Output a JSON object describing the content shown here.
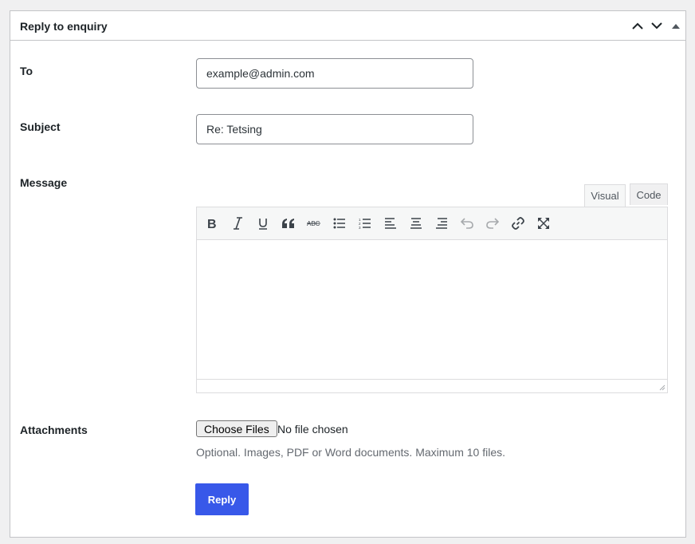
{
  "panel": {
    "title": "Reply to enquiry",
    "controls": {
      "move_up": "chevron-up-icon",
      "move_down": "chevron-down-icon",
      "toggle": "triangle-up-icon"
    }
  },
  "form": {
    "to": {
      "label": "To",
      "value": "example@admin.com"
    },
    "subject": {
      "label": "Subject",
      "value": "Re: Tetsing"
    },
    "message": {
      "label": "Message",
      "tabs": [
        "Visual",
        "Code"
      ],
      "active_tab": "Visual",
      "content": ""
    },
    "attachments": {
      "label": "Attachments",
      "button_label": "Choose Files",
      "status": "No file chosen",
      "help": "Optional. Images, PDF or Word documents. Maximum 10 files."
    },
    "submit_label": "Reply"
  },
  "toolbar_icons": [
    "bold-icon",
    "italic-icon",
    "underline-icon",
    "blockquote-icon",
    "strikethrough-icon",
    "bullet-list-icon",
    "numbered-list-icon",
    "align-left-icon",
    "align-center-icon",
    "align-right-icon",
    "undo-icon",
    "redo-icon",
    "link-icon",
    "fullscreen-icon"
  ],
  "colors": {
    "accent": "#3858e9",
    "border": "#c3c4c7",
    "toolbar_bg": "#f6f7f7"
  }
}
